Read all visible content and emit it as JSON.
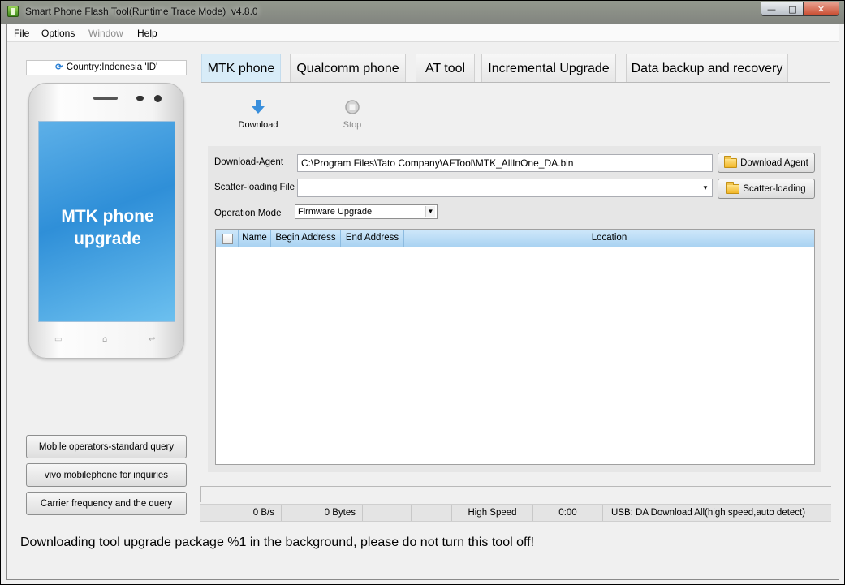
{
  "window": {
    "title": "Smart Phone Flash Tool(Runtime Trace Mode)",
    "version": "v4.8.0",
    "min_glyph": "—",
    "max_glyph": "□",
    "close_glyph": "✕"
  },
  "menu": {
    "items": [
      {
        "label": "File"
      },
      {
        "label": "Options"
      },
      {
        "label": "Window"
      },
      {
        "label": "Help"
      }
    ]
  },
  "left": {
    "country": "Country:Indonesia 'ID'",
    "phone_screen_line1": "MTK phone",
    "phone_screen_line2": "upgrade",
    "buttons": [
      {
        "label": "Mobile operators-standard query"
      },
      {
        "label": "vivo mobilephone for inquiries"
      },
      {
        "label": "Carrier frequency and the query"
      }
    ]
  },
  "tabs": [
    {
      "label": "MTK phone"
    },
    {
      "label": "Qualcomm phone"
    },
    {
      "label": "AT tool"
    },
    {
      "label": "Incremental Upgrade"
    },
    {
      "label": "Data backup and recovery"
    }
  ],
  "toolbar": {
    "download_label": "Download",
    "stop_label": "Stop"
  },
  "form": {
    "download_agent_label": "Download-Agent",
    "download_agent_value": "C:\\Program Files\\Tato Company\\AFTool\\MTK_AllInOne_DA.bin",
    "download_agent_button": "Download Agent",
    "scatter_label": "Scatter-loading File",
    "scatter_value": "",
    "scatter_button": "Scatter-loading",
    "operation_mode_label": "Operation Mode",
    "operation_mode_value": "Firmware Upgrade"
  },
  "table": {
    "columns": [
      "Name",
      "Begin Address",
      "End Address",
      "Location"
    ]
  },
  "status": {
    "speed": "0 B/s",
    "bytes": "0 Bytes",
    "mode": "High Speed",
    "time": "0:00",
    "usb": "USB: DA Download All(high speed,auto detect)"
  },
  "bottom_message": "Downloading tool upgrade package %1 in the background, please do not turn this tool off!",
  "colors": {
    "active_tab": "#d8ecf8",
    "table_header": "#a9d3f2",
    "phone_screen": "#2f8fd8"
  }
}
